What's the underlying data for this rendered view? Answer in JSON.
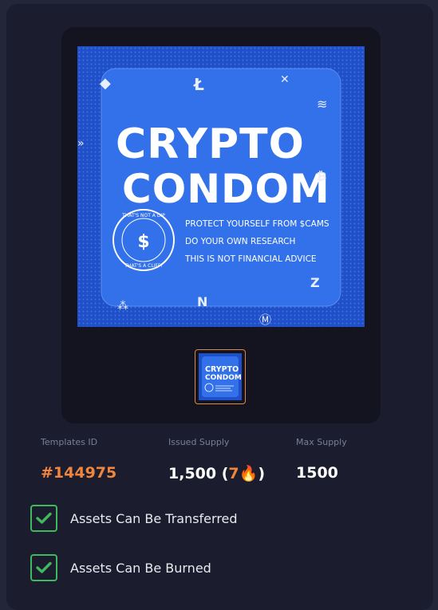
{
  "image": {
    "title_line1": "CRYPTO",
    "title_line2": "CONDOM",
    "seal_top_text": "THAT'S NOT A DIP",
    "seal_bottom_text": "THAT'S A CLIFF!",
    "tagline1": "PROTECT YOURSELF FROM $CAMS",
    "tagline2": "DO YOUR OWN RESEARCH",
    "tagline3": "THIS IS NOT FINANCIAL ADVICE"
  },
  "thumbnail": {
    "title_line1": "CRYPTO",
    "title_line2": "CONDOM"
  },
  "stats": {
    "template_label": "Templates ID",
    "template_value": "#144975",
    "issued_label": "Issued Supply",
    "issued_value": "1,500",
    "issued_burned": "7",
    "burn_emoji": "🔥",
    "max_label": "Max Supply",
    "max_value": "1500"
  },
  "checks": [
    {
      "label": "Assets Can Be Transferred",
      "checked": true
    },
    {
      "label": "Assets Can Be Burned",
      "checked": true
    }
  ],
  "colors": {
    "accent": "#f0863c",
    "check": "#3fb95c",
    "condom_blue": "#2f66e6"
  }
}
